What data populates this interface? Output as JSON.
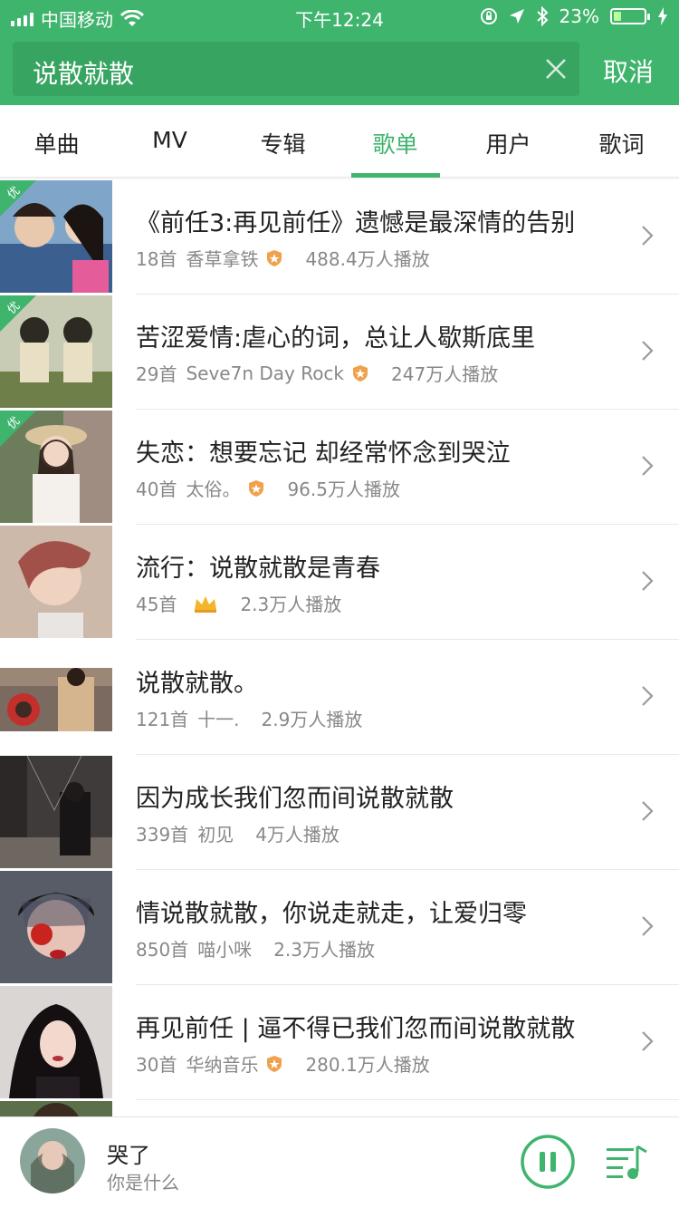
{
  "status": {
    "carrier": "中国移动",
    "time": "下午12:24",
    "battery": "23%"
  },
  "search": {
    "query": "说散就散",
    "cancel": "取消"
  },
  "tabs": [
    {
      "label": "单曲"
    },
    {
      "label": "MV"
    },
    {
      "label": "专辑"
    },
    {
      "label": "歌单",
      "active": true
    },
    {
      "label": "用户"
    },
    {
      "label": "歌词"
    }
  ],
  "badge_vip_text": "优",
  "playlists": [
    {
      "title": "《前任3:再见前任》遗憾是最深情的告别",
      "count": "18首",
      "creator": "香草拿铁",
      "badge": "star-badge",
      "plays": "488.4万人播放",
      "vip": true
    },
    {
      "title": "苦涩爱情:虐心的词，总让人歇斯底里",
      "count": "29首",
      "creator": "Seve7n Day Rock",
      "badge": "star-badge",
      "plays": "247万人播放",
      "vip": true
    },
    {
      "title": "失恋：想要忘记 却经常怀念到哭泣",
      "count": "40首",
      "creator": "太俗。",
      "badge": "star-badge",
      "plays": "96.5万人播放",
      "vip": true
    },
    {
      "title": "流行：说散就散是青春",
      "count": "45首",
      "creator": "",
      "badge": "crown",
      "plays": "2.3万人播放",
      "vip": false
    },
    {
      "title": "说散就散。",
      "count": "121首",
      "creator": "十一.",
      "badge": "",
      "plays": "2.9万人播放",
      "vip": false
    },
    {
      "title": "因为成长我们忽而间说散就散",
      "count": "339首",
      "creator": "初见",
      "badge": "",
      "plays": "4万人播放",
      "vip": false
    },
    {
      "title": "情说散就散，你说走就走，让爱归零",
      "count": "850首",
      "creator": "喵小咪",
      "badge": "",
      "plays": "2.3万人播放",
      "vip": false
    },
    {
      "title": "再见前任 | 逼不得已我们忽而间说散就散",
      "count": "30首",
      "creator": "华纳音乐",
      "badge": "star-badge",
      "plays": "280.1万人播放",
      "vip": false
    }
  ],
  "player": {
    "title": "哭了",
    "artist": "你是什么"
  },
  "colors": {
    "accent": "#3fb46d",
    "badge_orange": "#f0a14b"
  }
}
